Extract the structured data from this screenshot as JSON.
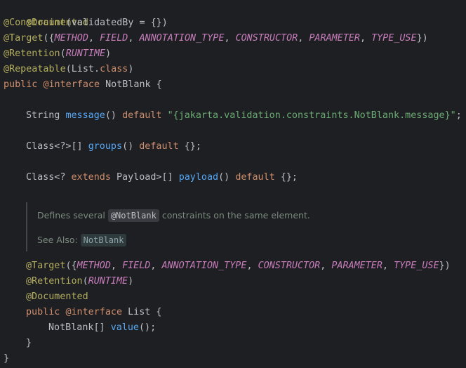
{
  "code": {
    "l1_ann": "@Documented",
    "l2_ann": "@Constraint",
    "l2_rest": "(validatedBy = {})",
    "l3_ann": "@Target",
    "l3_open": "({",
    "l3_c1": "METHOD",
    "l3_c2": "FIELD",
    "l3_c3": "ANNOTATION_TYPE",
    "l3_c4": "CONSTRUCTOR",
    "l3_c5": "PARAMETER",
    "l3_c6": "TYPE_USE",
    "l3_close": "})",
    "sep": ", ",
    "l4_ann": "@Retention",
    "l4_c": "RUNTIME",
    "l5_ann": "@Repeatable",
    "l5_mid": "(List.",
    "l5_class": "class",
    "paren_close": ")",
    "paren_open": "(",
    "l6_public": "public",
    "l6_interface": "@interface",
    "l6_name": " NotBlank {",
    "l7_type": "String ",
    "l7_fn": "message",
    "l7_parens": "() ",
    "l7_default": "default",
    "l7_str": "\"{jakarta.validation.constraints.NotBlank.message}\"",
    "l7_end": ";",
    "l8_type": "Class<?>[] ",
    "l8_fn": "groups",
    "l8_parens": "() ",
    "l8_default": "default",
    "l8_end": " {};",
    "l9_type1": "Class<? ",
    "l9_extends": "extends",
    "l9_type2": " Payload>[] ",
    "l9_fn": "payload",
    "l9_parens": "() ",
    "l9_default": "default",
    "l9_end": " {};",
    "l12_public": "public",
    "l12_interface": "@interface",
    "l12_name": " List {",
    "l13_type": "NotBlank[] ",
    "l13_fn": "value",
    "l13_end": "();",
    "brace_close": "}",
    "space": " "
  },
  "doc": {
    "text_before": "Defines several ",
    "code": "@NotBlank",
    "text_after": " constraints on the same element.",
    "see_also_label": "See Also: ",
    "see_also_link": "NotBlank"
  }
}
